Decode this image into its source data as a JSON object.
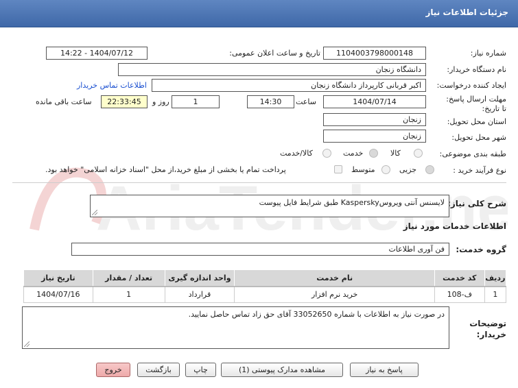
{
  "header": {
    "title": "جزئیات اطلاعات نیاز"
  },
  "form": {
    "need_number_label": "شماره نیاز:",
    "need_number": "1104003798000148",
    "announce_label": "تاریخ و ساعت اعلان عمومی:",
    "announce_value": "1404/07/12 - 14:22",
    "buyer_org_label": "نام دستگاه خریدار:",
    "buyer_org": "دانشگاه زنجان",
    "creator_label": "ایجاد کننده درخواست:",
    "creator": "اکبر قربانی کارپرداز دانشگاه زنجان",
    "contact_link": "اطلاعات تماس خریدار",
    "deadline_label": "مهلت ارسال پاسخ: تا تاریخ:",
    "deadline_date": "1404/07/14",
    "time_label": "ساعت",
    "deadline_time": "14:30",
    "days_value": "1",
    "days_label": "روز و",
    "remaining_time": "22:33:45",
    "remaining_label": "ساعت باقی مانده",
    "province_label": "استان محل تحویل:",
    "province": "زنجان",
    "city_label": "شهر محل تحویل:",
    "city": "زنجان",
    "category_label": "طبقه بندی موضوعی:",
    "category_options": [
      "کالا",
      "خدمت",
      "کالا/خدمت"
    ],
    "process_label": "نوع فرآیند خرید :",
    "process_options": [
      "جزیی",
      "متوسط"
    ],
    "payment_note": "پرداخت تمام یا بخشی از مبلغ خرید،از محل \"اسناد خزانه اسلامی\" خواهد بود."
  },
  "general_description": {
    "label": "شرح کلی نیاز:",
    "value": "لایسنس آنتی ویروسKaspersky طبق شرایط فایل پیوست"
  },
  "services": {
    "section_title": "اطلاعات خدمات مورد نیاز",
    "group_label": "گروه خدمت:",
    "group_value": "فن آوری اطلاعات",
    "table": {
      "headers": [
        "ردیف",
        "کد خدمت",
        "نام خدمت",
        "واحد اندازه گیری",
        "تعداد / مقدار",
        "تاریخ نیاز"
      ],
      "rows": [
        [
          "1",
          "ف-108",
          "خرید نرم افزار",
          "قرارداد",
          "1",
          "1404/07/16"
        ]
      ]
    }
  },
  "buyer_notes": {
    "label": "توضیحات خریدار:",
    "value": "در صورت نیاز به اطلاعات با شماره 33052650 آقای حق زاد تماس حاصل نمایید."
  },
  "buttons": {
    "reply": "پاسخ به نیاز",
    "attachments": "مشاهده مدارک پیوستی (1)",
    "print": "چاپ",
    "back": "بازگشت",
    "exit": "خروج"
  },
  "watermark_text": "AriaTender.net",
  "colors": {
    "header": "#4a72b0",
    "link": "#1a4fd0",
    "highlight": "#ffffcc",
    "exit_button": "#eeaaaa"
  }
}
